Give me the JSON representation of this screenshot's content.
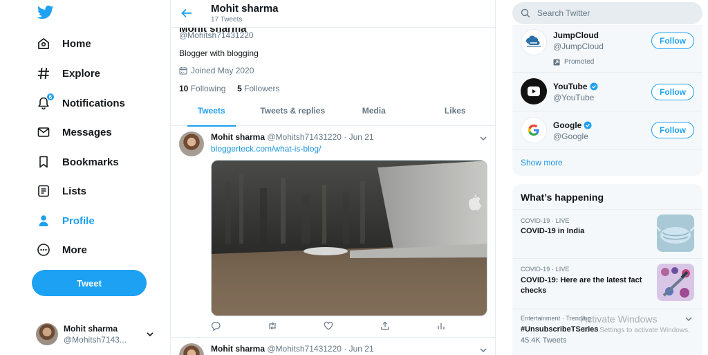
{
  "nav": {
    "items": [
      {
        "label": "Home",
        "icon": "home-icon"
      },
      {
        "label": "Explore",
        "icon": "hashtag-icon"
      },
      {
        "label": "Notifications",
        "icon": "bell-icon",
        "badge": "6"
      },
      {
        "label": "Messages",
        "icon": "mail-icon"
      },
      {
        "label": "Bookmarks",
        "icon": "bookmark-icon"
      },
      {
        "label": "Lists",
        "icon": "list-icon"
      },
      {
        "label": "Profile",
        "icon": "person-icon"
      },
      {
        "label": "More",
        "icon": "more-icon"
      }
    ],
    "active": "Profile",
    "tweet_button": "Tweet",
    "account": {
      "name": "Mohit sharma",
      "handle": "@Mohitsh7143..."
    }
  },
  "header": {
    "title": "Mohit sharma",
    "subtitle": "17 Tweets"
  },
  "profile": {
    "name": "Mohit sharma",
    "handle": "@Mohitsh71431220",
    "bio": "Blogger with blogging",
    "joined": "Joined May 2020",
    "following_count": "10",
    "following_label": "Following",
    "followers_count": "5",
    "followers_label": "Followers"
  },
  "tabs": [
    {
      "label": "Tweets",
      "active": true
    },
    {
      "label": "Tweets & replies",
      "active": false
    },
    {
      "label": "Media",
      "active": false
    },
    {
      "label": "Likes",
      "active": false
    }
  ],
  "tweets": [
    {
      "name": "Mohit sharma",
      "handle": "@Mohitsh71431220",
      "date": "Jun 21",
      "link": "bloggerteck.com/what-is-blog/"
    },
    {
      "name": "Mohit sharma",
      "handle": "@Mohitsh71431220",
      "date": "Jun 21"
    }
  ],
  "search": {
    "placeholder": "Search Twitter"
  },
  "who_to_follow": [
    {
      "name": "JumpCloud",
      "handle": "@JumpCloud",
      "promoted": "Promoted",
      "button": "Follow"
    },
    {
      "name": "YouTube",
      "handle": "@YouTube",
      "verified": true,
      "button": "Follow"
    },
    {
      "name": "Google",
      "handle": "@Google",
      "verified": true,
      "button": "Follow"
    }
  ],
  "show_more": "Show more",
  "happening": {
    "title": "What’s happening",
    "trends": [
      {
        "context": "COVID-19 · LIVE",
        "title": "COVID-19 in India"
      },
      {
        "context": "COVID-19 · LIVE",
        "title": "COVID-19: Here are the latest fact checks"
      },
      {
        "context": "Entertainment · Trending",
        "title": "#UnsubscribeTSeries",
        "count": "45.4K Tweets"
      }
    ]
  },
  "watermark": {
    "line1": "Activate Windows",
    "line2": "Go to Settings to activate Windows."
  },
  "colors": {
    "accent": "#1da1f2",
    "text": "#14171a",
    "secondary": "#657786",
    "panel": "#f5f8fa"
  }
}
